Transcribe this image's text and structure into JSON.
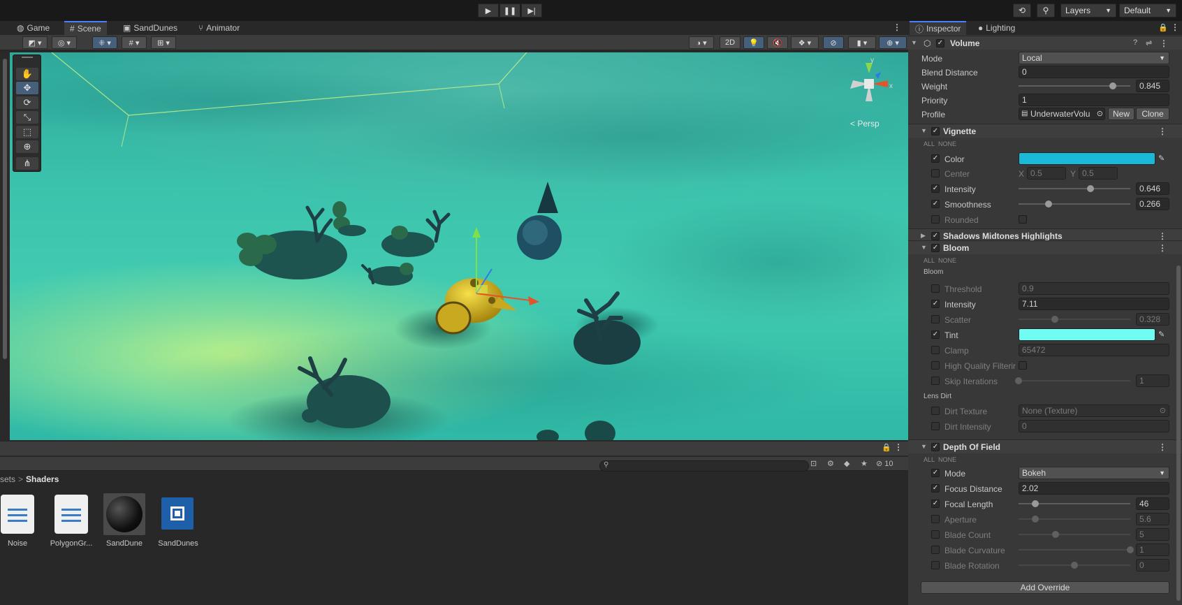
{
  "toolbar": {
    "play_icon": "play-icon",
    "pause_icon": "pause-icon",
    "step_icon": "step-icon",
    "layers_label": "Layers",
    "layout_label": "Default"
  },
  "scene_tabs": [
    {
      "label": "Game",
      "icon": "gamepad-icon"
    },
    {
      "label": "Scene",
      "icon": "grid-icon"
    },
    {
      "label": "SandDunes",
      "icon": "shader-icon"
    },
    {
      "label": "Animator",
      "icon": "animator-icon"
    }
  ],
  "scene_toolbar": {
    "twod_label": "2D",
    "persp_label": "< Persp",
    "gizmo_x": "x",
    "gizmo_y": "y"
  },
  "project": {
    "breadcrumb_parent": "sets",
    "breadcrumb_sep": ">",
    "breadcrumb_current": "Shaders",
    "hidden_count": "10",
    "assets": [
      {
        "name": "Noise",
        "type": "doc"
      },
      {
        "name": "PolygonGr...",
        "type": "doc"
      },
      {
        "name": "SandDune",
        "type": "material"
      },
      {
        "name": "SandDunes",
        "type": "shadergraph"
      }
    ]
  },
  "inspector": {
    "tabs": [
      {
        "label": "Inspector",
        "icon": "info-icon"
      },
      {
        "label": "Lighting",
        "icon": "bulb-icon"
      }
    ],
    "component": "Volume",
    "mode_label": "Mode",
    "mode_value": "Local",
    "blend_label": "Blend Distance",
    "blend_value": "0",
    "weight_label": "Weight",
    "weight_value": "0.845",
    "weight_fraction": 0.845,
    "priority_label": "Priority",
    "priority_value": "1",
    "profile_label": "Profile",
    "profile_value": "UnderwaterVolu",
    "new_label": "New",
    "clone_label": "Clone",
    "all_label": "ALL",
    "none_label": "NONE",
    "vignette": {
      "title": "Vignette",
      "color_label": "Color",
      "color": "#1cb8d8",
      "center_label": "Center",
      "center_x_label": "X",
      "center_x": "0.5",
      "center_y_label": "Y",
      "center_y": "0.5",
      "intensity_label": "Intensity",
      "intensity": "0.646",
      "intensity_fraction": 0.646,
      "smoothness_label": "Smoothness",
      "smoothness": "0.266",
      "smoothness_fraction": 0.266,
      "rounded_label": "Rounded"
    },
    "smh_title": "Shadows Midtones Highlights",
    "bloom": {
      "title": "Bloom",
      "section_label": "Bloom",
      "threshold_label": "Threshold",
      "threshold": "0.9",
      "intensity_label": "Intensity",
      "intensity": "7.11",
      "scatter_label": "Scatter",
      "scatter": "0.328",
      "scatter_fraction": 0.328,
      "tint_label": "Tint",
      "tint": "#6ffcf2",
      "clamp_label": "Clamp",
      "clamp": "65472",
      "hq_label": "High Quality Filterir",
      "skip_label": "Skip Iterations",
      "skip": "1",
      "skip_fraction": 0.0,
      "lens_dirt_label": "Lens Dirt",
      "dirt_texture_label": "Dirt Texture",
      "dirt_texture": "None (Texture)",
      "dirt_intensity_label": "Dirt Intensity",
      "dirt_intensity": "0"
    },
    "dof": {
      "title": "Depth Of Field",
      "mode_label": "Mode",
      "mode": "Bokeh",
      "focus_label": "Focus Distance",
      "focus": "2.02",
      "focal_label": "Focal Length",
      "focal": "46",
      "focal_fraction": 0.15,
      "aperture_label": "Aperture",
      "aperture": "5.6",
      "aperture_fraction": 0.15,
      "blade_count_label": "Blade Count",
      "blade_count": "5",
      "blade_count_fraction": 0.33,
      "blade_curv_label": "Blade Curvature",
      "blade_curv": "1",
      "blade_curv_fraction": 1.0,
      "blade_rot_label": "Blade Rotation",
      "blade_rot": "0",
      "blade_rot_fraction": 0.5
    },
    "add_override_label": "Add Override"
  }
}
